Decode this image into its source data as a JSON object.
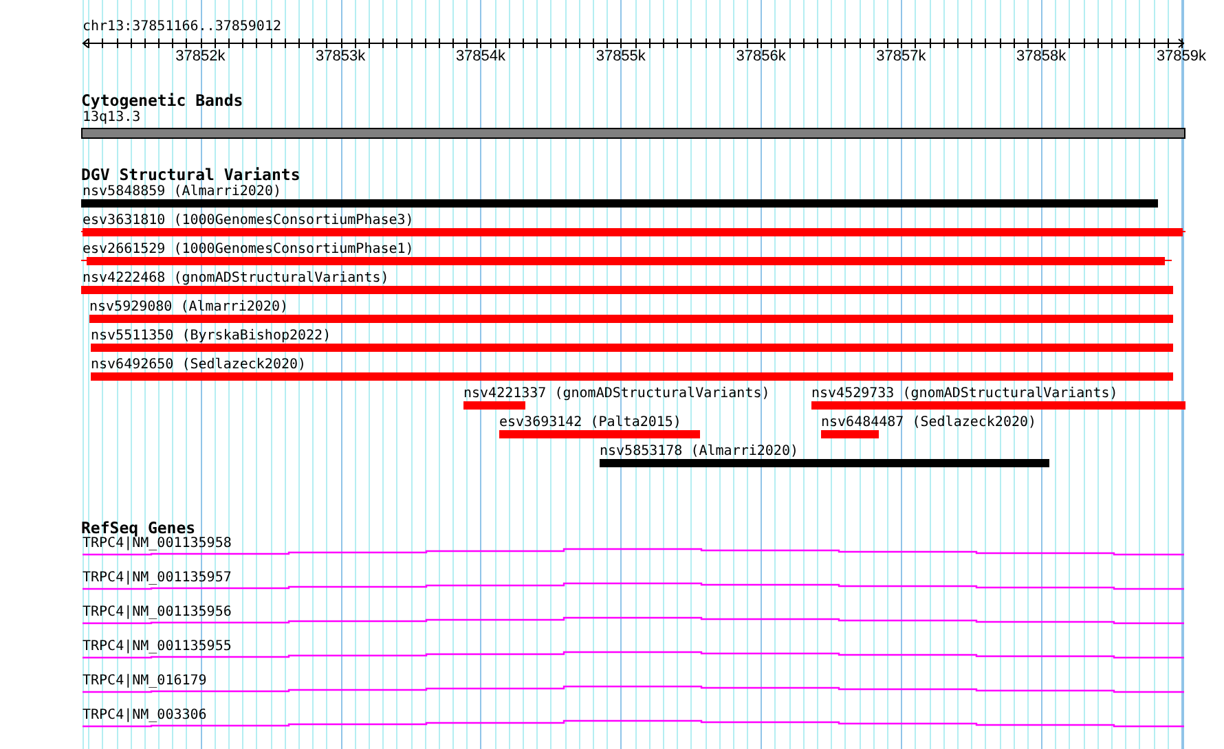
{
  "ruler": {
    "region": "chr13:37851166..37859012",
    "ticks": [
      "37852k",
      "37853k",
      "37854k",
      "37855k",
      "37856k",
      "37857k",
      "37858k",
      "37859k"
    ]
  },
  "cytogenetic_bands": {
    "title": "Cytogenetic Bands",
    "band": "13q13.3"
  },
  "dgv_structural_variants": {
    "title": "DGV Structural Variants",
    "features": [
      {
        "label": "nsv5848859 (Almarri2020)",
        "color": "#000000"
      },
      {
        "label": "esv3631810 (1000GenomesConsortiumPhase3)",
        "color": "#ff0000"
      },
      {
        "label": "esv2661529 (1000GenomesConsortiumPhase1)",
        "color": "#ff0000"
      },
      {
        "label": "nsv4222468 (gnomADStructuralVariants)",
        "color": "#ff0000"
      },
      {
        "label": "nsv5929080 (Almarri2020)",
        "color": "#ff0000"
      },
      {
        "label": "nsv5511350 (ByrskaBishop2022)",
        "color": "#ff0000"
      },
      {
        "label": "nsv6492650 (Sedlazeck2020)",
        "color": "#ff0000"
      },
      {
        "label": "nsv4221337 (gnomADStructuralVariants)",
        "color": "#ff0000"
      },
      {
        "label": "nsv4529733 (gnomADStructuralVariants)",
        "color": "#ff0000"
      },
      {
        "label": "esv3693142 (Palta2015)",
        "color": "#ff0000"
      },
      {
        "label": "nsv6484487 (Sedlazeck2020)",
        "color": "#ff0000"
      },
      {
        "label": "nsv5853178 (Almarri2020)",
        "color": "#000000"
      }
    ]
  },
  "refseq_genes": {
    "title": "RefSeq Genes",
    "genes": [
      "TRPC4|NM_001135958",
      "TRPC4|NM_001135957",
      "TRPC4|NM_001135956",
      "TRPC4|NM_001135955",
      "TRPC4|NM_016179",
      "TRPC4|NM_003306"
    ]
  }
}
